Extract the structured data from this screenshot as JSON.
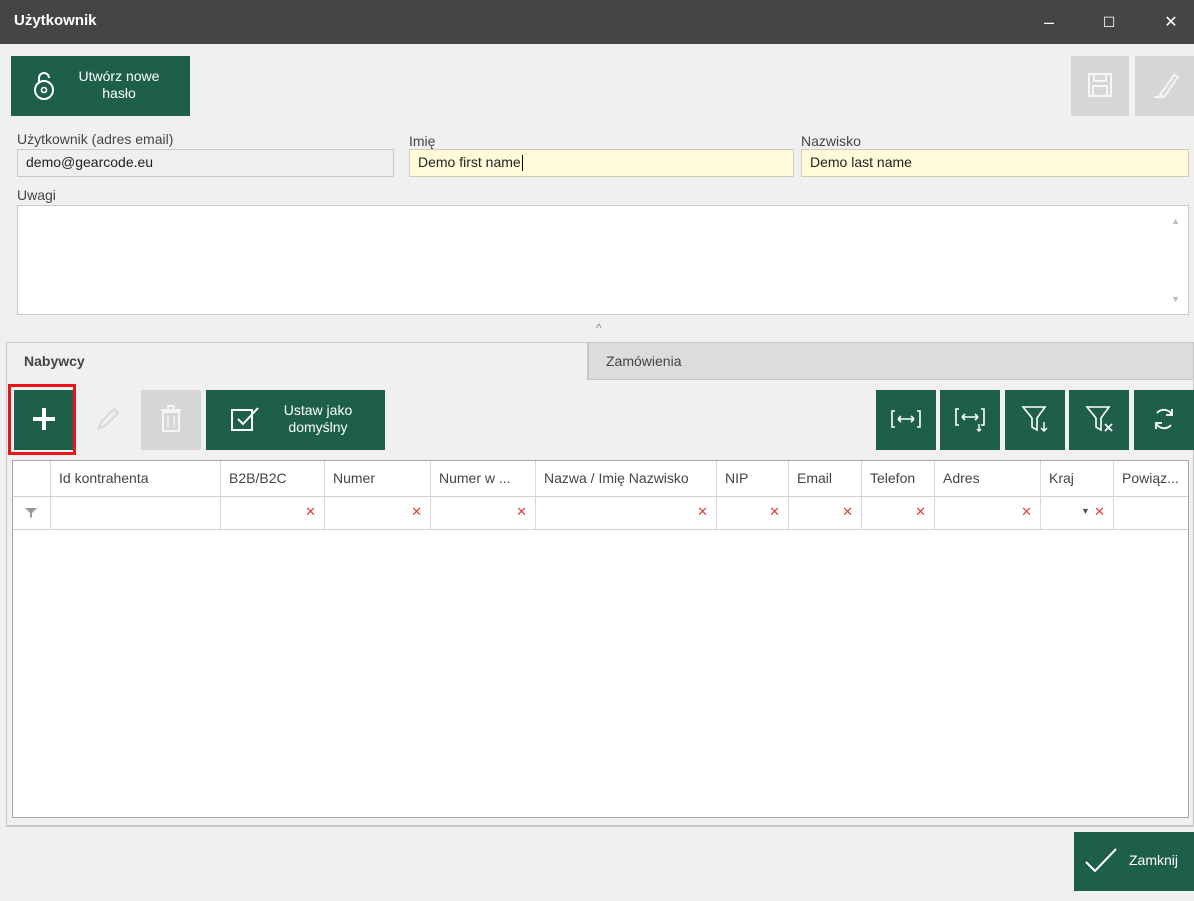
{
  "window": {
    "title": "Użytkownik",
    "minimize_glyph": "–",
    "maximize_glyph": "☐",
    "close_glyph": "✕"
  },
  "toolbar": {
    "new_password_label": "Utwórz nowe hasło",
    "new_password_icon": "lock-open-icon",
    "save_icon": "save-icon",
    "clear_icon": "eraser-icon"
  },
  "form": {
    "user_label": "Użytkownik (adres email)",
    "user_value": "demo@gearcode.eu",
    "first_name_label": "Imię",
    "first_name_value": "Demo first name",
    "last_name_label": "Nazwisko",
    "last_name_value": "Demo last name",
    "notes_label": "Uwagi",
    "notes_value": ""
  },
  "splitter_glyph": "^",
  "tabs": [
    {
      "label": "Nabywcy",
      "active": true
    },
    {
      "label": "Zamówienia",
      "active": false
    }
  ],
  "grid_toolbar": {
    "add_icon": "plus-icon",
    "edit_icon": "pencil-icon",
    "delete_icon": "trash-icon",
    "set_default_label": "Ustaw jako domyślny",
    "right_icons": [
      "fit-columns-icon",
      "fit-columns-down-icon",
      "filter-down-icon",
      "filter-clear-icon",
      "refresh-icon"
    ]
  },
  "grid": {
    "columns": [
      "Id kontrahenta",
      "B2B/B2C",
      "Numer",
      "Numer w ...",
      "Nazwa / Imię Nazwisko",
      "NIP",
      "Email",
      "Telefon",
      "Adres",
      "Kraj",
      "Powiąz..."
    ],
    "rows": []
  },
  "footer": {
    "close_label": "Zamknij"
  },
  "colors": {
    "accent": "#1e5f49",
    "titlebar": "#454545",
    "highlight": "#e8151d",
    "input_yellow": "#fffbd9"
  }
}
